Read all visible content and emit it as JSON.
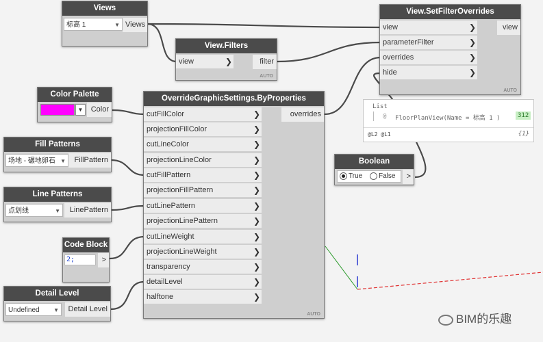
{
  "nodes": {
    "views": {
      "title": "Views",
      "selected": "标高 1",
      "output": "Views"
    },
    "view_filters": {
      "title": "View.Filters",
      "input": "view",
      "output": "filter",
      "auto": "AUTO"
    },
    "set_filter_overrides": {
      "title": "View.SetFilterOverrides",
      "inputs": [
        "view",
        "parameterFilter",
        "overrides",
        "hide"
      ],
      "output": "view",
      "auto": "AUTO"
    },
    "color_palette": {
      "title": "Color Palette",
      "color": "#ff00ff",
      "output": "Color"
    },
    "fill_patterns": {
      "title": "Fill Patterns",
      "selected": "场地 - 碾地卵石",
      "output": "FillPattern"
    },
    "line_patterns": {
      "title": "Line Patterns",
      "selected": "点划线",
      "output": "LinePattern"
    },
    "code_block": {
      "title": "Code Block",
      "code": "2;",
      "output": ">"
    },
    "detail_level": {
      "title": "Detail Level",
      "selected": "Undefined",
      "output": "Detail Level"
    },
    "override_settings": {
      "title": "OverrideGraphicSettings.ByProperties",
      "inputs": [
        "cutFillColor",
        "projectionFillColor",
        "cutLineColor",
        "projectionLineColor",
        "cutFillPattern",
        "projectionFillPattern",
        "cutLinePattern",
        "projectionLinePattern",
        "cutLineWeight",
        "projectionLineWeight",
        "transparency",
        "detailLevel",
        "halftone"
      ],
      "output": "overrides",
      "auto": "AUTO"
    },
    "boolean": {
      "title": "Boolean",
      "true_label": "True",
      "false_label": "False",
      "selected": "True",
      "output": ">"
    }
  },
  "preview": {
    "header": "List",
    "index": "@",
    "item": "FloorPlanView(Name = 标高 1 )",
    "badge": "312",
    "levels": "@L2 @L1",
    "count": "{1}"
  },
  "watermark": "BIM的乐趣"
}
